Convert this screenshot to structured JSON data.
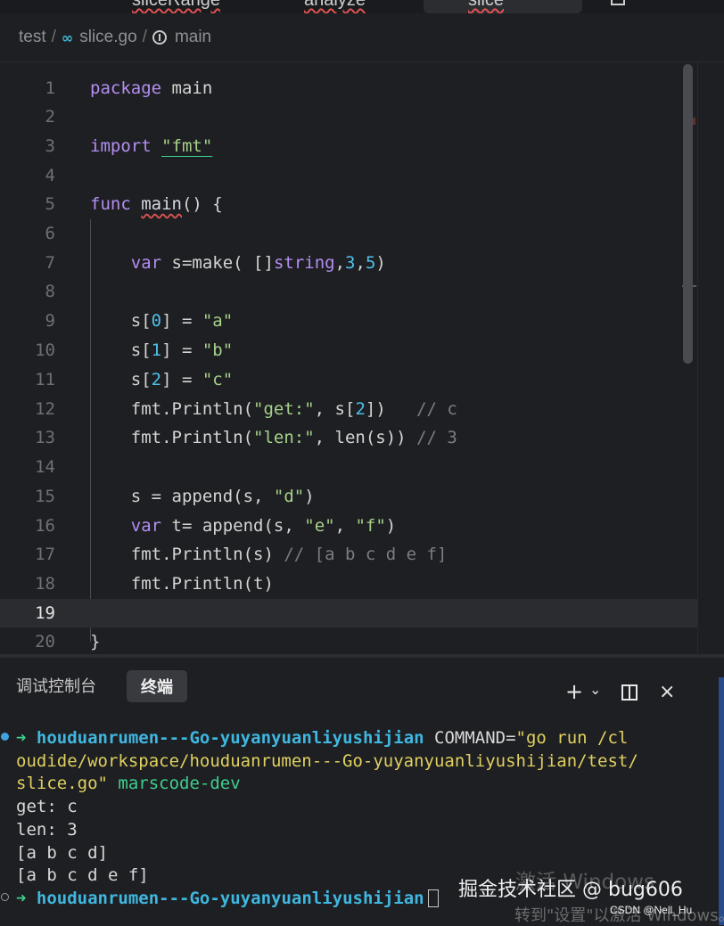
{
  "tabs": [
    "sliceRange",
    "analyze",
    "slice"
  ],
  "breadcrumb": {
    "folder": "test",
    "separator": "/",
    "file": "slice.go",
    "symbol": "main",
    "go_icon": "go-file-icon",
    "symbol_icon": "function-icon"
  },
  "editor": {
    "current_line": 19,
    "line_numbers": [
      "1",
      "2",
      "3",
      "4",
      "5",
      "6",
      "7",
      "8",
      "9",
      "10",
      "11",
      "12",
      "13",
      "14",
      "15",
      "16",
      "17",
      "18",
      "19",
      "20"
    ]
  },
  "panel": {
    "tabs": [
      "调试控制台",
      "终端"
    ],
    "active_tab": "终端",
    "tools": {
      "add": "+",
      "dropdown": "⌄",
      "close": "×"
    }
  },
  "terminal": {
    "prompt_arrow": "➜",
    "cwd": "houduanrumen---Go-yuyanyuanliyushijian",
    "command_part1": " COMMAND=",
    "command_str_1": "\"go run /cl",
    "command_str_2": "oudide/workspace/houduanrumen---Go-yuyanyuanliyushijian/test/",
    "command_str_3": "slice.go\"",
    "command_tail": " marscode-dev",
    "output": [
      "get: c",
      "len: 3",
      "[a b c d]",
      "[a b c d e f]"
    ]
  },
  "overlays": {
    "watermark": "掘金技术社区 @ bug606",
    "activate_title": "激活 Windows",
    "activate_sub": "转到\"设置\"以激活 Windows。",
    "csdn": "CSDN @Nell_Hu"
  },
  "colors": {
    "background": "#1e1f22",
    "keyword": "#b48ef2",
    "string": "#a6d189",
    "number": "#4fc1e9",
    "comment": "#7b7d85",
    "prompt": "#3ecf8e",
    "cwd": "#3fb7e0"
  }
}
